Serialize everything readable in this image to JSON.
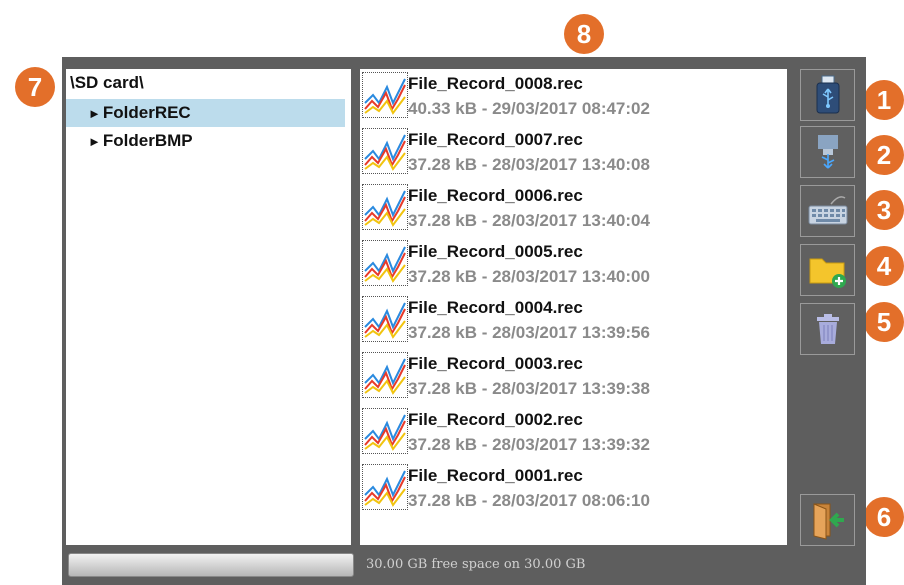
{
  "badges": [
    "7",
    "8",
    "1",
    "2",
    "3",
    "4",
    "5",
    "6"
  ],
  "tree": {
    "root": "\\SD card\\",
    "items": [
      {
        "label": "FolderREC",
        "selected": true
      },
      {
        "label": "FolderBMP",
        "selected": false
      }
    ]
  },
  "files": [
    {
      "name": "File_Record_0008.rec",
      "meta": "40.33 kB - 29/03/2017 08:47:02"
    },
    {
      "name": "File_Record_0007.rec",
      "meta": "37.28 kB - 28/03/2017 13:40:08"
    },
    {
      "name": "File_Record_0006.rec",
      "meta": "37.28 kB - 28/03/2017 13:40:04"
    },
    {
      "name": "File_Record_0005.rec",
      "meta": "37.28 kB - 28/03/2017 13:40:00"
    },
    {
      "name": "File_Record_0004.rec",
      "meta": "37.28 kB - 28/03/2017 13:39:56"
    },
    {
      "name": "File_Record_0003.rec",
      "meta": "37.28 kB - 28/03/2017 13:39:38"
    },
    {
      "name": "File_Record_0002.rec",
      "meta": "37.28 kB - 28/03/2017 13:39:32"
    },
    {
      "name": "File_Record_0001.rec",
      "meta": "37.28 kB - 28/03/2017 08:06:10"
    }
  ],
  "toolbar": {
    "icons": [
      "usb-stick-icon",
      "usb-transfer-icon",
      "keyboard-icon",
      "new-folder-icon",
      "trash-icon",
      "exit-icon"
    ]
  },
  "status": {
    "free_space": "30.00 GB free space on 30.00 GB",
    "usage_fraction": 0.0
  },
  "colors": {
    "badge": "#e36f2a",
    "selection": "#bcdcec",
    "frame": "#5e5e5e"
  }
}
